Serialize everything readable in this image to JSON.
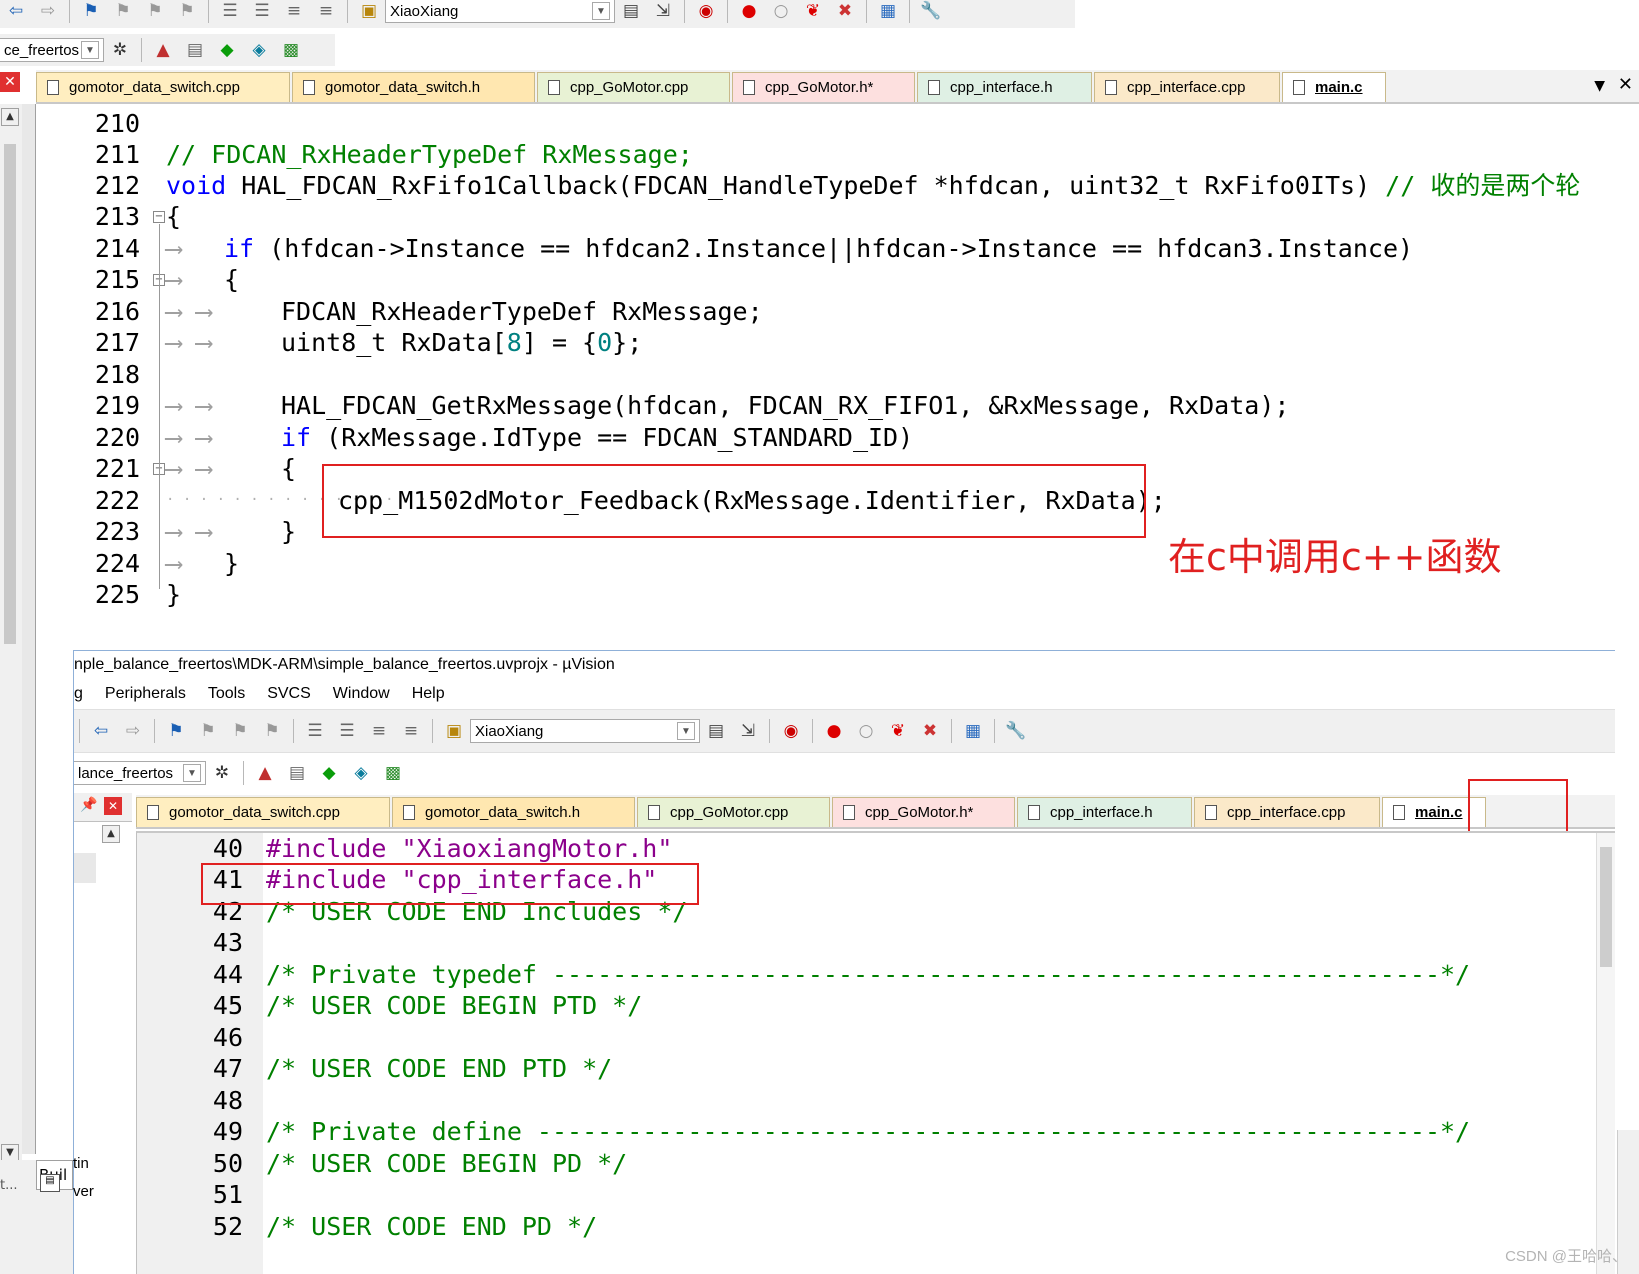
{
  "back_window": {
    "toolbar1": {
      "target_combo": "XiaoXiang"
    },
    "toolbar2": {
      "project_combo": "ce_freertos"
    },
    "tabs": [
      {
        "label": "gomotor_data_switch.cpp"
      },
      {
        "label": "gomotor_data_switch.h"
      },
      {
        "label": "cpp_GoMotor.cpp"
      },
      {
        "label": "cpp_GoMotor.h*"
      },
      {
        "label": "cpp_interface.h"
      },
      {
        "label": "cpp_interface.cpp"
      },
      {
        "label": "main.c"
      }
    ],
    "lines": [
      {
        "n": "210"
      },
      {
        "n": "211"
      },
      {
        "n": "212"
      },
      {
        "n": "213"
      },
      {
        "n": "214"
      },
      {
        "n": "215"
      },
      {
        "n": "216"
      },
      {
        "n": "217"
      },
      {
        "n": "218"
      },
      {
        "n": "219"
      },
      {
        "n": "220"
      },
      {
        "n": "221"
      },
      {
        "n": "222"
      },
      {
        "n": "223"
      },
      {
        "n": "224"
      },
      {
        "n": "225"
      }
    ],
    "code": {
      "l211": "// FDCAN_RxHeaderTypeDef RxMessage;",
      "l212_kw": "void",
      "l212_rest": " HAL_FDCAN_RxFifo1Callback(FDCAN_HandleTypeDef *hfdcan, uint32_t RxFifo0ITs) ",
      "l212_cm": "// 收的是两个轮",
      "l213": "{",
      "l214_kw": "if",
      "l214_rest": " (hfdcan->Instance == hfdcan2.Instance||hfdcan->Instance == hfdcan3.Instance)",
      "l215": "{",
      "l216": "FDCAN_RxHeaderTypeDef RxMessage;",
      "l217_a": "uint8_t RxData[",
      "l217_num": "8",
      "l217_b": "] = {",
      "l217_num2": "0",
      "l217_c": "};",
      "l219": "HAL_FDCAN_GetRxMessage(hfdcan, FDCAN_RX_FIFO1, &RxMessage, RxData);",
      "l220_kw": "if",
      "l220_rest": " (RxMessage.IdType == FDCAN_STANDARD_ID)",
      "l221": "{",
      "l222": "cpp_M1502dMotor_Feedback(RxMessage.Identifier, RxData);",
      "l223": "}",
      "l224": "}",
      "l225": "}"
    },
    "annotation": "在c中调用c++函数",
    "bottom_panel": {
      "tab_build": "Buil",
      "tab_time": "tin",
      "tab_ver": "ver",
      "left_text": "t..."
    }
  },
  "front_window": {
    "title": "nple_balance_freertos\\MDK-ARM\\simple_balance_freertos.uvprojx - µVision",
    "menu": [
      "g",
      "Peripherals",
      "Tools",
      "SVCS",
      "Window",
      "Help"
    ],
    "toolbar1": {
      "target_combo": "XiaoXiang"
    },
    "toolbar2": {
      "project_combo": "lance_freertos"
    },
    "tabs": [
      {
        "label": "gomotor_data_switch.cpp"
      },
      {
        "label": "gomotor_data_switch.h"
      },
      {
        "label": "cpp_GoMotor.cpp"
      },
      {
        "label": "cpp_GoMotor.h*"
      },
      {
        "label": "cpp_interface.h"
      },
      {
        "label": "cpp_interface.cpp"
      },
      {
        "label": "main.c"
      }
    ],
    "lines": [
      {
        "n": "40"
      },
      {
        "n": "41"
      },
      {
        "n": "42"
      },
      {
        "n": "43"
      },
      {
        "n": "44"
      },
      {
        "n": "45"
      },
      {
        "n": "46"
      },
      {
        "n": "47"
      },
      {
        "n": "48"
      },
      {
        "n": "49"
      },
      {
        "n": "50"
      },
      {
        "n": "51"
      },
      {
        "n": "52"
      }
    ],
    "code": {
      "l40_pp": "#include",
      "l40_str": "\"XiaoxiangMotor.h\"",
      "l41_pp": "#include",
      "l41_str": "\"cpp_interface.h\"",
      "l42": "/* USER CODE END Includes */",
      "l44": "/* Private typedef -----------------------------------------------------------*/",
      "l45": "/* USER CODE BEGIN PTD */",
      "l47": "/* USER CODE END PTD */",
      "l49": "/* Private define ------------------------------------------------------------*/",
      "l50": "/* USER CODE BEGIN PD */",
      "l52": "/* USER CODE END PD */"
    }
  },
  "watermark": "CSDN @王哈哈、",
  "colors": {
    "keyword": "#0000ff",
    "comment": "#008000",
    "string": "#8b008b",
    "number": "#008080",
    "highlight_box": "#e02020"
  }
}
